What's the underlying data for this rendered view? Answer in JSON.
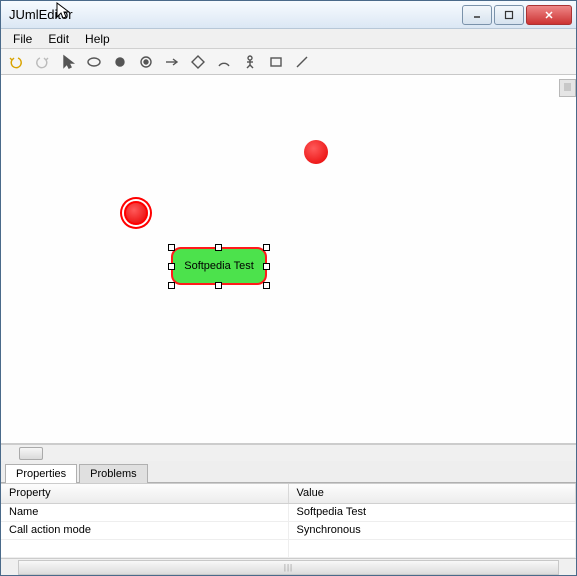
{
  "window": {
    "title": "JUmlEditor"
  },
  "menu": {
    "items": [
      "File",
      "Edit",
      "Help"
    ]
  },
  "toolbar": {
    "items": [
      "undo-icon",
      "redo-icon",
      "pointer-icon",
      "ellipse-icon",
      "filled-circle-icon",
      "circle-target-icon",
      "arrow-right-icon",
      "diamond-icon",
      "arc-icon",
      "stick-figure-icon",
      "rectangle-icon",
      "line-icon"
    ]
  },
  "canvas": {
    "shape_label": "Softpedia Test"
  },
  "tabs": {
    "items": [
      "Properties",
      "Problems"
    ],
    "active": 0
  },
  "properties": {
    "headers": [
      "Property",
      "Value"
    ],
    "rows": [
      {
        "key": "Name",
        "value": "Softpedia Test"
      },
      {
        "key": "Call action mode",
        "value": "Synchronous"
      }
    ]
  }
}
